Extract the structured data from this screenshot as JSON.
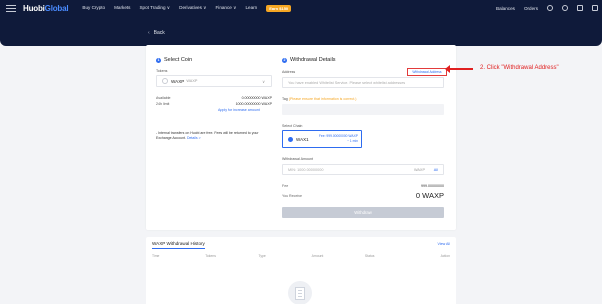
{
  "nav": {
    "logo_prefix": "Huobi",
    "logo_suffix": "Global",
    "links": [
      "Buy Crypto",
      "Markets",
      "Spot Trading ∨",
      "Derivatives ∨",
      "Finance ∨",
      "Learn"
    ],
    "promo": "Earn $150",
    "right_links": [
      "Balances",
      "Orders"
    ]
  },
  "back_label": "Back",
  "select_coin": {
    "title": "Select Coin",
    "step": "1",
    "tokens_label": "Tokens",
    "coin_symbol": "WAXP",
    "coin_name": "WAXP",
    "available_label": "Available",
    "available_value": "0.00000000 WAXP",
    "limit_label": "24h limit",
    "limit_value": "1000.00000000 WAXP",
    "increase_link": "Apply for increase amount",
    "note": "- Internal transfers on Huobi are free. Fees will be returned to your Exchange Account.",
    "note_link": "Details >"
  },
  "details": {
    "title": "Withdrawal Details",
    "step": "2",
    "address_label": "Address",
    "address_book": "Withdrawal Address",
    "address_placeholder": "You have enabled Whitelist Service. Please select whitelist addresses",
    "tag_label": "Tag",
    "tag_warning": "(Please ensure that information is correct.)",
    "chain_label": "Select Chain",
    "chain_name": "WAX1",
    "chain_fee": "Fee: 999.00000000 WAXP",
    "chain_time": "~ 1 min",
    "amount_label": "Withdrawal Amount",
    "amount_placeholder": "MIN: 1000.00000000",
    "amount_unit": "WAXP",
    "amount_all": "All",
    "fee_label": "Fee",
    "fee_value": "999.00000000",
    "receive_label": "You Receive",
    "receive_value": "0 WAXP",
    "withdraw_button": "Withdraw"
  },
  "history": {
    "title": "WAXP Withdrawal History",
    "view_all": "View All",
    "columns": [
      "Time",
      "Tokens",
      "Type",
      "Amount",
      "Status",
      "Action"
    ]
  },
  "annotation": "2. Click \"Withdrawal Address\""
}
